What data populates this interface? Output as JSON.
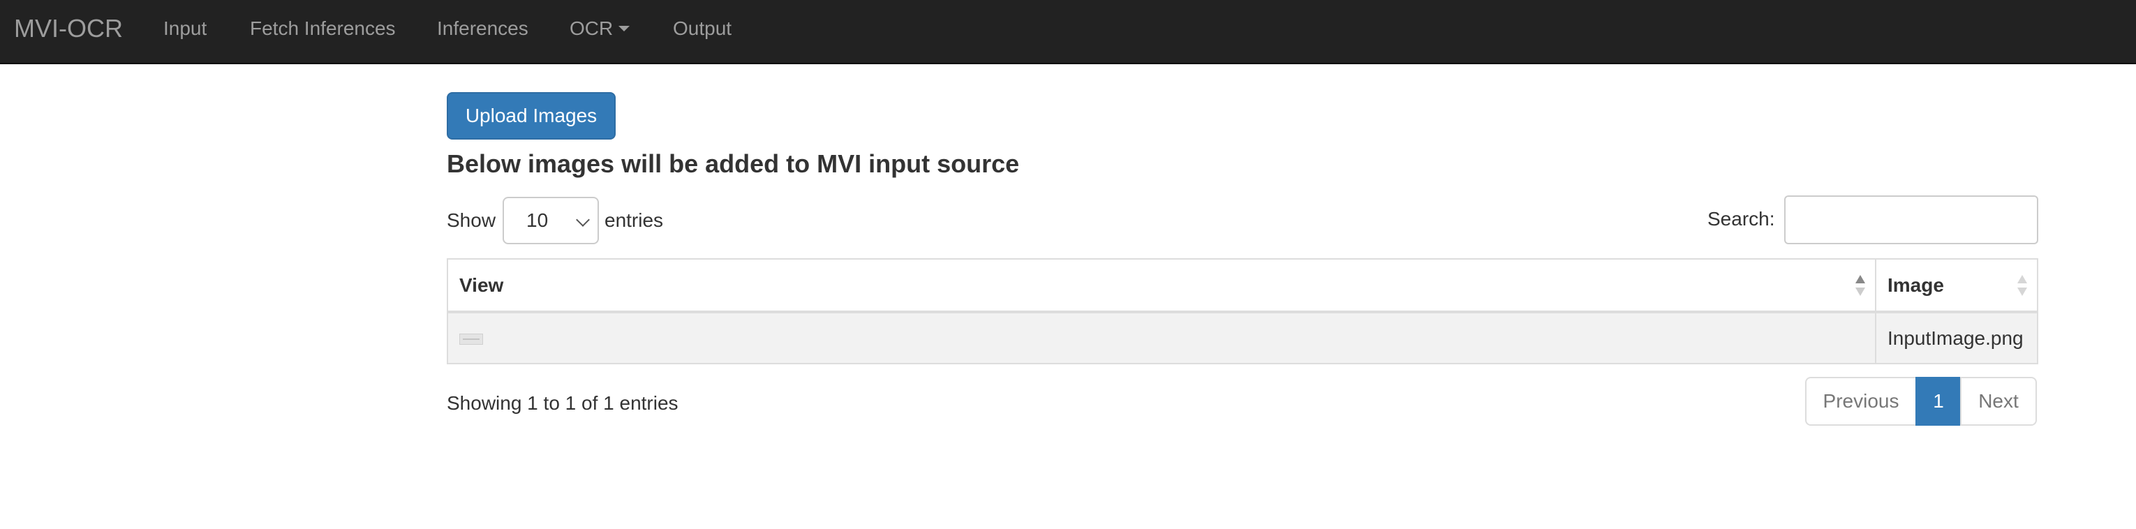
{
  "navbar": {
    "brand": "MVI-OCR",
    "items": [
      {
        "label": "Input"
      },
      {
        "label": "Fetch Inferences"
      },
      {
        "label": "Inferences"
      },
      {
        "label": "OCR",
        "dropdown": true
      },
      {
        "label": "Output"
      }
    ]
  },
  "upload": {
    "button_label": "Upload Images"
  },
  "heading": "Below images will be added to MVI input source",
  "length_menu": {
    "show_label": "Show",
    "selected": "10",
    "entries_label": "entries"
  },
  "search": {
    "label": "Search:",
    "value": ""
  },
  "table": {
    "headers": [
      "View",
      "Image"
    ],
    "rows": [
      {
        "view": "thumbnail",
        "image": "InputImage.png"
      }
    ]
  },
  "info": "Showing 1 to 1 of 1 entries",
  "pagination": {
    "previous": "Previous",
    "current": "1",
    "next": "Next"
  },
  "colors": {
    "navbar_bg": "#222222",
    "primary": "#337ab7",
    "row_bg": "#f2f2f2"
  }
}
